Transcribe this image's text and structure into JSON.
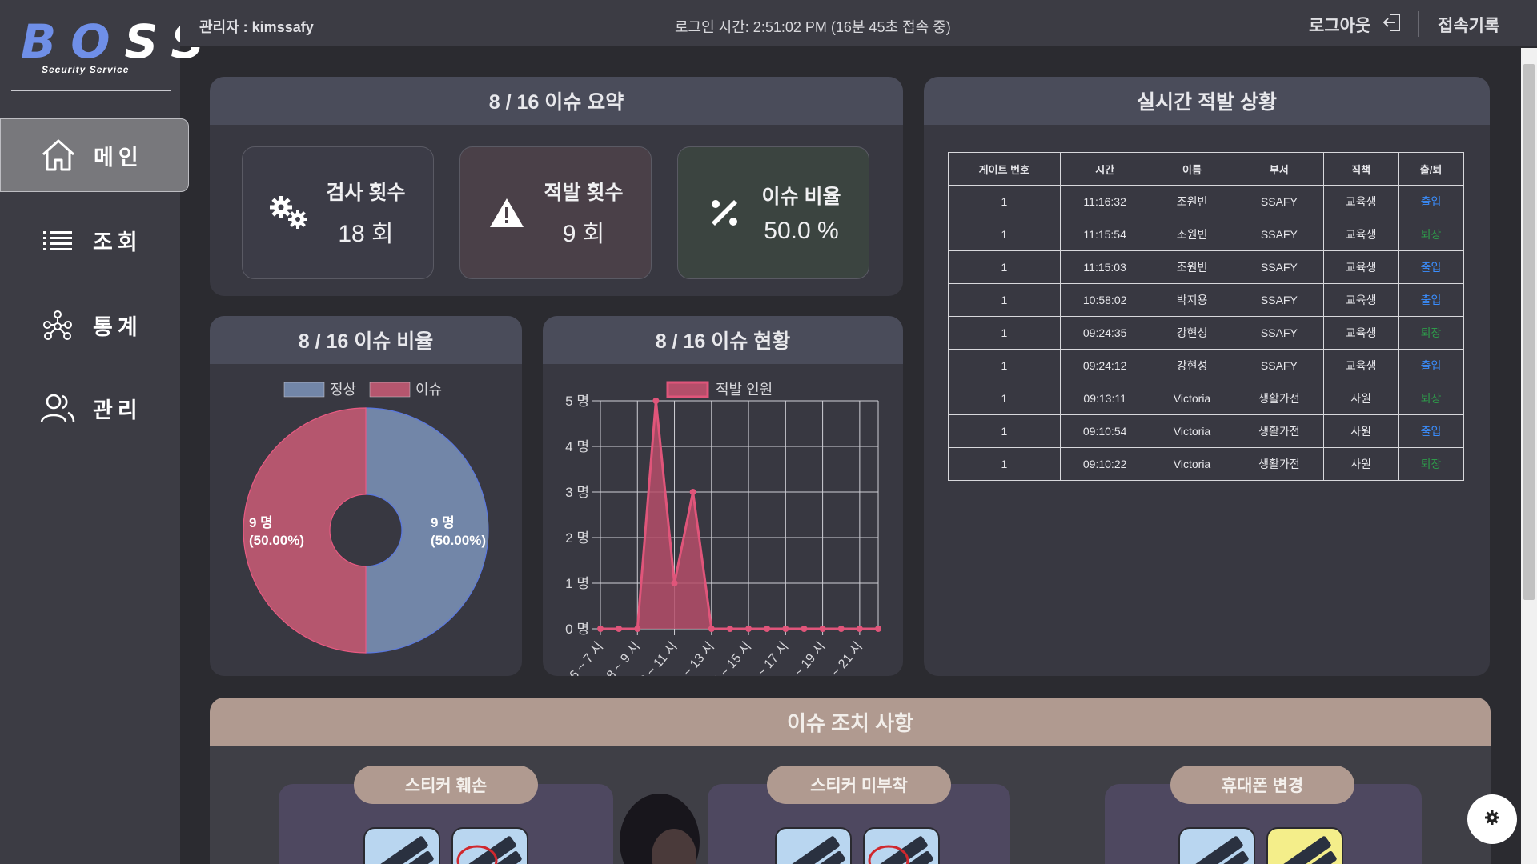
{
  "logo": {
    "main": "BOSS",
    "sub": "Security Service"
  },
  "nav": [
    {
      "label": "메인",
      "icon": "home-icon",
      "active": true
    },
    {
      "label": "조회",
      "icon": "list-icon",
      "active": false
    },
    {
      "label": "통계",
      "icon": "network-icon",
      "active": false
    },
    {
      "label": "관리",
      "icon": "users-icon",
      "active": false
    }
  ],
  "topbar": {
    "admin": "관리자 : kimssafy",
    "login_time": "로그인 시간: 2:51:02 PM (16분 45초 접속 중)",
    "logout": "로그아웃",
    "history": "접속기록"
  },
  "summary": {
    "title": "8 / 16 이슈 요약",
    "stats": [
      {
        "label": "검사 횟수",
        "value": "18 회",
        "icon": "gears-icon",
        "bg": "#3c3c47"
      },
      {
        "label": "적발 횟수",
        "value": "9 회",
        "icon": "warning-icon",
        "bg": "#4a4048"
      },
      {
        "label": "이슈 비율",
        "value": "50.0 %",
        "icon": "percent-icon",
        "bg": "#3b4440"
      }
    ]
  },
  "ratio_chart": {
    "title": "8 / 16 이슈 비율",
    "chart_data": {
      "type": "pie",
      "labels": [
        "정상",
        "이슈"
      ],
      "values": [
        9,
        9
      ],
      "slice_labels": [
        "9 명\n(50.00%)",
        "9 명\n(50.00%)"
      ],
      "colors": [
        "#7286a8",
        "#b5566e"
      ],
      "legend": "top"
    }
  },
  "status_chart": {
    "title": "8 / 16 이슈 현황",
    "chart_data": {
      "type": "area",
      "series": [
        {
          "name": "적발 인원",
          "values": [
            0,
            0,
            0,
            5,
            1,
            3,
            0,
            0,
            0,
            0,
            0,
            0,
            0,
            0,
            0,
            0
          ]
        }
      ],
      "x_tick_labels": [
        "6 ~ 7 시",
        "8 ~ 9 시",
        "10 ~ 11 시",
        "12 ~ 13 시",
        "14 ~ 15 시",
        "16 ~ 17 시",
        "18 ~ 19 시",
        "20 ~ 21 시"
      ],
      "y_tick_labels": [
        "0 명",
        "1 명",
        "2 명",
        "3 명",
        "4 명",
        "5 명"
      ],
      "ylim": [
        0,
        5
      ],
      "color": "#e0557a",
      "legend": "top",
      "grid": true
    }
  },
  "detections": {
    "title": "실시간 적발 상황",
    "columns": [
      "게이트 번호",
      "시간",
      "이름",
      "부서",
      "직책",
      "출/퇴"
    ],
    "rows": [
      [
        "1",
        "11:16:32",
        "조원빈",
        "SSAFY",
        "교육생",
        "출입"
      ],
      [
        "1",
        "11:15:54",
        "조원빈",
        "SSAFY",
        "교육생",
        "퇴장"
      ],
      [
        "1",
        "11:15:03",
        "조원빈",
        "SSAFY",
        "교육생",
        "출입"
      ],
      [
        "1",
        "10:58:02",
        "박지용",
        "SSAFY",
        "교육생",
        "출입"
      ],
      [
        "1",
        "09:24:35",
        "강현성",
        "SSAFY",
        "교육생",
        "퇴장"
      ],
      [
        "1",
        "09:24:12",
        "강현성",
        "SSAFY",
        "교육생",
        "출입"
      ],
      [
        "1",
        "09:13:11",
        "Victoria",
        "생활가전",
        "사원",
        "퇴장"
      ],
      [
        "1",
        "09:10:54",
        "Victoria",
        "생활가전",
        "사원",
        "출입"
      ],
      [
        "1",
        "09:10:22",
        "Victoria",
        "생활가전",
        "사원",
        "퇴장"
      ]
    ]
  },
  "actions": {
    "title": "이슈 조치 사항",
    "items": [
      {
        "label": "스티커 훼손"
      },
      {
        "label": "스티커 미부착"
      },
      {
        "label": "휴대폰 변경"
      }
    ]
  },
  "colors": {
    "in": "#3a8eff",
    "out": "#2e9a4a",
    "accent": "#b09a90"
  }
}
